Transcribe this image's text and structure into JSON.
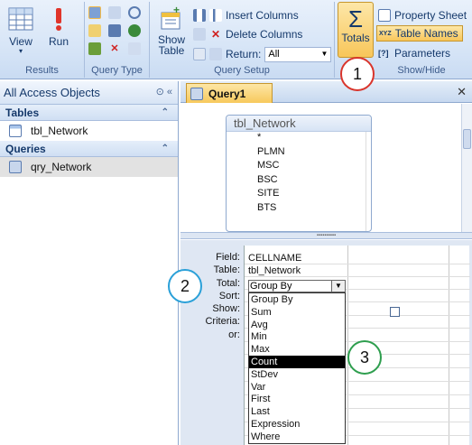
{
  "ribbon": {
    "results": {
      "label": "Results",
      "view": "View",
      "run": "Run"
    },
    "query_type": {
      "label": "Query Type"
    },
    "query_setup": {
      "label": "Query Setup",
      "show_table": "Show Table",
      "insert_columns": "Insert Columns",
      "delete_columns": "Delete Columns",
      "return_label": "Return:",
      "return_value": "All"
    },
    "show_hide": {
      "label": "Show/Hide",
      "totals": "Totals",
      "property_sheet": "Property Sheet",
      "table_names": "Table Names",
      "parameters": "Parameters"
    }
  },
  "nav": {
    "title": "All Access Objects",
    "tables_header": "Tables",
    "tables": [
      "tbl_Network"
    ],
    "queries_header": "Queries",
    "queries": [
      "qry_Network"
    ]
  },
  "document": {
    "tab_label": "Query1",
    "field_list": {
      "title": "tbl_Network",
      "fields": [
        "*",
        "PLMN",
        "MSC",
        "BSC",
        "SITE",
        "BTS"
      ]
    },
    "grid": {
      "row_labels": [
        "Field:",
        "Table:",
        "Total:",
        "Sort:",
        "Show:",
        "Criteria:",
        "or:"
      ],
      "field_value": "CELLNAME",
      "table_value": "tbl_Network",
      "total_value": "Group By",
      "total_options": [
        "Group By",
        "Sum",
        "Avg",
        "Min",
        "Max",
        "Count",
        "StDev",
        "Var",
        "First",
        "Last",
        "Expression",
        "Where"
      ],
      "highlighted_option": "Count"
    }
  },
  "callouts": [
    "1",
    "2",
    "3"
  ],
  "colors": {
    "callout1": "#d9342b",
    "callout2": "#2aa0d8",
    "callout3": "#2e9e4e"
  }
}
